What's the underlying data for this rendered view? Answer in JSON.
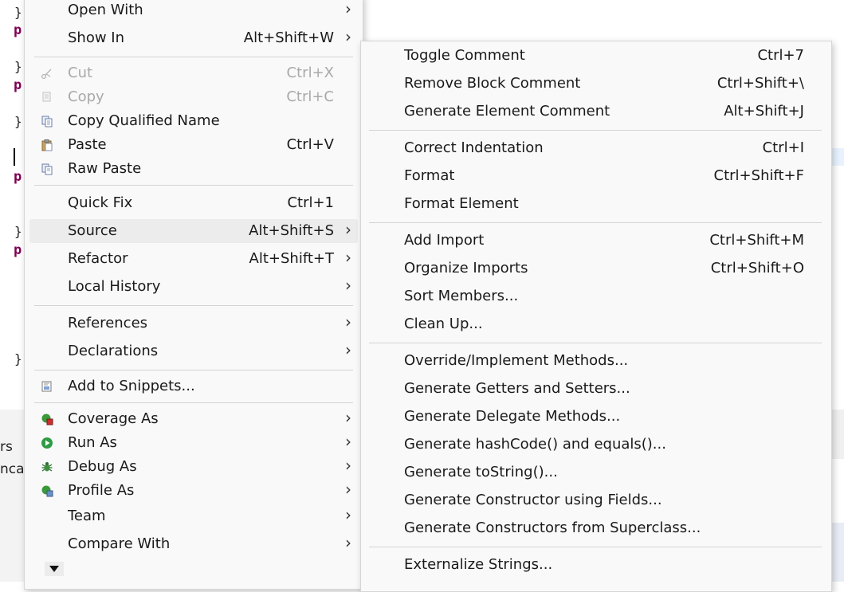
{
  "editor": {
    "brace1": "}",
    "kw1": "p",
    "brace2": "}",
    "kw2": "p",
    "brace3": "}",
    "kw3": "p",
    "brace4": "}",
    "kw4": "p",
    "brace5": "}",
    "tab_text1": "rs",
    "tab_text2": "nca"
  },
  "context_menu": {
    "items": [
      {
        "label": "Open With",
        "shortcut": "",
        "submenu": true,
        "icon": "none"
      },
      {
        "label": "Show In",
        "shortcut": "Alt+Shift+W",
        "submenu": true,
        "icon": "none"
      },
      {
        "label": "Cut",
        "shortcut": "Ctrl+X",
        "submenu": false,
        "icon": "scissors-icon",
        "disabled": true
      },
      {
        "label": "Copy",
        "shortcut": "Ctrl+C",
        "submenu": false,
        "icon": "copy-icon",
        "disabled": true
      },
      {
        "label": "Copy Qualified Name",
        "shortcut": "",
        "submenu": false,
        "icon": "copy-qualified-icon"
      },
      {
        "label": "Paste",
        "shortcut": "Ctrl+V",
        "submenu": false,
        "icon": "paste-icon"
      },
      {
        "label": "Raw Paste",
        "shortcut": "",
        "submenu": false,
        "icon": "raw-paste-icon"
      },
      {
        "label": "Quick Fix",
        "shortcut": "Ctrl+1",
        "submenu": false,
        "icon": "none"
      },
      {
        "label": "Source",
        "shortcut": "Alt+Shift+S",
        "submenu": true,
        "icon": "none",
        "highlighted": true
      },
      {
        "label": "Refactor",
        "shortcut": "Alt+Shift+T",
        "submenu": true,
        "icon": "none"
      },
      {
        "label": "Local History",
        "shortcut": "",
        "submenu": true,
        "icon": "none"
      },
      {
        "label": "References",
        "shortcut": "",
        "submenu": true,
        "icon": "none"
      },
      {
        "label": "Declarations",
        "shortcut": "",
        "submenu": true,
        "icon": "none"
      },
      {
        "label": "Add to Snippets...",
        "shortcut": "",
        "submenu": false,
        "icon": "snippet-icon"
      },
      {
        "label": "Coverage As",
        "shortcut": "",
        "submenu": true,
        "icon": "coverage-icon"
      },
      {
        "label": "Run As",
        "shortcut": "",
        "submenu": true,
        "icon": "run-icon"
      },
      {
        "label": "Debug As",
        "shortcut": "",
        "submenu": true,
        "icon": "debug-icon"
      },
      {
        "label": "Profile As",
        "shortcut": "",
        "submenu": true,
        "icon": "profile-icon"
      },
      {
        "label": "Team",
        "shortcut": "",
        "submenu": true,
        "icon": "none"
      },
      {
        "label": "Compare With",
        "shortcut": "",
        "submenu": true,
        "icon": "none"
      }
    ]
  },
  "source_submenu": {
    "items": [
      {
        "label": "Toggle Comment",
        "shortcut": "Ctrl+7"
      },
      {
        "label": "Remove Block Comment",
        "shortcut": "Ctrl+Shift+\\"
      },
      {
        "label": "Generate Element Comment",
        "shortcut": "Alt+Shift+J"
      },
      {
        "label": "Correct Indentation",
        "shortcut": "Ctrl+I"
      },
      {
        "label": "Format",
        "shortcut": "Ctrl+Shift+F"
      },
      {
        "label": "Format Element",
        "shortcut": ""
      },
      {
        "label": "Add Import",
        "shortcut": "Ctrl+Shift+M"
      },
      {
        "label": "Organize Imports",
        "shortcut": "Ctrl+Shift+O"
      },
      {
        "label": "Sort Members...",
        "shortcut": ""
      },
      {
        "label": "Clean Up...",
        "shortcut": ""
      },
      {
        "label": "Override/Implement Methods...",
        "shortcut": ""
      },
      {
        "label": "Generate Getters and Setters...",
        "shortcut": ""
      },
      {
        "label": "Generate Delegate Methods...",
        "shortcut": ""
      },
      {
        "label": "Generate hashCode() and equals()...",
        "shortcut": ""
      },
      {
        "label": "Generate toString()...",
        "shortcut": ""
      },
      {
        "label": "Generate Constructor using Fields...",
        "shortcut": ""
      },
      {
        "label": "Generate Constructors from Superclass...",
        "shortcut": ""
      },
      {
        "label": "Externalize Strings...",
        "shortcut": ""
      }
    ]
  },
  "colors": {
    "keyword": "#7f0055",
    "menu_bg": "#f9f9f9",
    "hover_bg": "#ececec",
    "disabled_text": "#a9a9a9"
  }
}
